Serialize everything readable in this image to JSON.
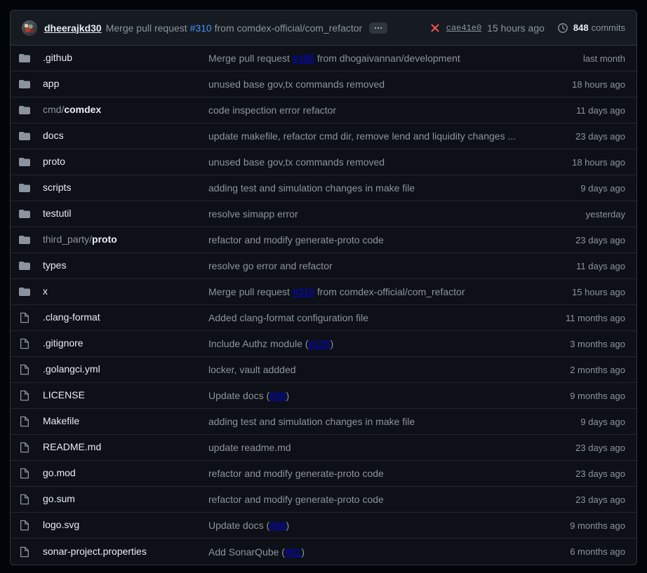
{
  "header": {
    "avatar_name": "avatar",
    "author": "dheerajkd30",
    "message_prefix": "Merge pull request ",
    "message_pr": "#310",
    "message_suffix": " from comdex-official/com_refactor",
    "ellipsis_label": "...",
    "status_icon": "x-circle-fail-icon",
    "commit_sha": "cae41e0",
    "commit_time": "15 hours ago",
    "history_icon": "history-clock-icon",
    "commits_count": "848",
    "commits_label": "commits"
  },
  "colors": {
    "background": "#0d1117",
    "header_background": "#161b22",
    "border": "#30363d",
    "row_border": "#21262d",
    "text_primary": "#e6edf3",
    "text_muted": "#8b949e",
    "link": "#4493f8",
    "fail_red": "#f85149",
    "icon_gray": "#8b949e"
  },
  "rows": [
    {
      "icon": "folder-icon",
      "type": "folder",
      "name": ".github",
      "name_dim": "",
      "name_strong": "",
      "msg_prefix": "Merge pull request ",
      "msg_link": "#185",
      "msg_suffix": " from dhogaivannan/development",
      "age": "last month"
    },
    {
      "icon": "folder-icon",
      "type": "folder",
      "name": "app",
      "name_dim": "",
      "name_strong": "",
      "msg_prefix": "unused base gov,tx commands removed",
      "msg_link": "",
      "msg_suffix": "",
      "age": "18 hours ago"
    },
    {
      "icon": "folder-icon",
      "type": "folder",
      "name": "",
      "name_dim": "cmd/",
      "name_strong": "comdex",
      "msg_prefix": "code inspection error refactor",
      "msg_link": "",
      "msg_suffix": "",
      "age": "11 days ago"
    },
    {
      "icon": "folder-icon",
      "type": "folder",
      "name": "docs",
      "name_dim": "",
      "name_strong": "",
      "msg_prefix": "update makefile, refactor cmd dir, remove lend and liquidity changes ...",
      "msg_link": "",
      "msg_suffix": "",
      "age": "23 days ago"
    },
    {
      "icon": "folder-icon",
      "type": "folder",
      "name": "proto",
      "name_dim": "",
      "name_strong": "",
      "msg_prefix": "unused base gov,tx commands removed",
      "msg_link": "",
      "msg_suffix": "",
      "age": "18 hours ago"
    },
    {
      "icon": "folder-icon",
      "type": "folder",
      "name": "scripts",
      "name_dim": "",
      "name_strong": "",
      "msg_prefix": "adding test and simulation changes in make file",
      "msg_link": "",
      "msg_suffix": "",
      "age": "9 days ago"
    },
    {
      "icon": "folder-icon",
      "type": "folder",
      "name": "testutil",
      "name_dim": "",
      "name_strong": "",
      "msg_prefix": "resolve simapp error",
      "msg_link": "",
      "msg_suffix": "",
      "age": "yesterday"
    },
    {
      "icon": "folder-icon",
      "type": "folder",
      "name": "",
      "name_dim": "third_party/",
      "name_strong": "proto",
      "msg_prefix": "refactor and modify generate-proto code",
      "msg_link": "",
      "msg_suffix": "",
      "age": "23 days ago"
    },
    {
      "icon": "folder-icon",
      "type": "folder",
      "name": "types",
      "name_dim": "",
      "name_strong": "",
      "msg_prefix": "resolve go error and refactor",
      "msg_link": "",
      "msg_suffix": "",
      "age": "11 days ago"
    },
    {
      "icon": "folder-icon",
      "type": "folder",
      "name": "x",
      "name_dim": "",
      "name_strong": "",
      "msg_prefix": "Merge pull request ",
      "msg_link": "#310",
      "msg_suffix": " from comdex-official/com_refactor",
      "age": "15 hours ago"
    },
    {
      "icon": "file-icon",
      "type": "file",
      "name": ".clang-format",
      "name_dim": "",
      "name_strong": "",
      "msg_prefix": "Added clang-format configuration file",
      "msg_link": "",
      "msg_suffix": "",
      "age": "11 months ago"
    },
    {
      "icon": "file-icon",
      "type": "file",
      "name": ".gitignore",
      "name_dim": "",
      "name_strong": "",
      "msg_prefix": "Include Authz module (",
      "msg_link": "#125",
      "msg_suffix": ")",
      "age": "3 months ago"
    },
    {
      "icon": "file-icon",
      "type": "file",
      "name": ".golangci.yml",
      "name_dim": "",
      "name_strong": "",
      "msg_prefix": "locker, vault addded",
      "msg_link": "",
      "msg_suffix": "",
      "age": "2 months ago"
    },
    {
      "icon": "file-icon",
      "type": "file",
      "name": "LICENSE",
      "name_dim": "",
      "name_strong": "",
      "msg_prefix": "Update docs (",
      "msg_link": "#56",
      "msg_suffix": ")",
      "age": "9 months ago"
    },
    {
      "icon": "file-icon",
      "type": "file",
      "name": "Makefile",
      "name_dim": "",
      "name_strong": "",
      "msg_prefix": "adding test and simulation changes in make file",
      "msg_link": "",
      "msg_suffix": "",
      "age": "9 days ago"
    },
    {
      "icon": "file-icon",
      "type": "file",
      "name": "README.md",
      "name_dim": "",
      "name_strong": "",
      "msg_prefix": "update readme.md",
      "msg_link": "",
      "msg_suffix": "",
      "age": "23 days ago"
    },
    {
      "icon": "file-icon",
      "type": "file",
      "name": "go.mod",
      "name_dim": "",
      "name_strong": "",
      "msg_prefix": "refactor and modify generate-proto code",
      "msg_link": "",
      "msg_suffix": "",
      "age": "23 days ago"
    },
    {
      "icon": "file-icon",
      "type": "file",
      "name": "go.sum",
      "name_dim": "",
      "name_strong": "",
      "msg_prefix": "refactor and modify generate-proto code",
      "msg_link": "",
      "msg_suffix": "",
      "age": "23 days ago"
    },
    {
      "icon": "file-icon",
      "type": "file",
      "name": "logo.svg",
      "name_dim": "",
      "name_strong": "",
      "msg_prefix": "Update docs (",
      "msg_link": "#56",
      "msg_suffix": ")",
      "age": "9 months ago"
    },
    {
      "icon": "file-icon",
      "type": "file",
      "name": "sonar-project.properties",
      "name_dim": "",
      "name_strong": "",
      "msg_prefix": "Add SonarQube (",
      "msg_link": "#81",
      "msg_suffix": ")",
      "age": "6 months ago"
    }
  ]
}
